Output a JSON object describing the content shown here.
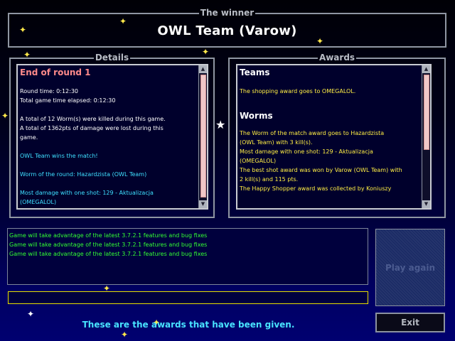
{
  "winner_panel": {
    "title": "The winner",
    "name": "OWL Team   (Varow)"
  },
  "details_panel": {
    "title": "Details",
    "round_heading": "End of round 1",
    "lines": [
      {
        "text": "Round time: 0:12:30",
        "color": "white"
      },
      {
        "text": "Total game time elapsed: 0:12:30",
        "color": "white"
      },
      {
        "text": "",
        "color": "white"
      },
      {
        "text": "A total of 12 Worm(s) were killed during this game.",
        "color": "white"
      },
      {
        "text": "A total of 1362pts of damage were lost during this",
        "color": "white"
      },
      {
        "text": "game.",
        "color": "white"
      },
      {
        "text": "",
        "color": "white"
      },
      {
        "text": "OWL Team wins the match!",
        "color": "cyan"
      },
      {
        "text": "",
        "color": "white"
      },
      {
        "text": "Worm of the round: Hazardzista (OWL Team)",
        "color": "cyan"
      },
      {
        "text": "",
        "color": "white"
      },
      {
        "text": "Most damage with one shot: 129 - Aktualizacja",
        "color": "cyan"
      },
      {
        "text": "(OMEGALOL)",
        "color": "cyan"
      }
    ]
  },
  "awards_panel": {
    "title": "Awards",
    "teams_heading": "Teams",
    "teams_lines": [
      "The shopping award goes to OMEGALOL."
    ],
    "worms_heading": "Worms",
    "worms_lines": [
      "The Worm of the match award goes to Hazardzista",
      "(OWL Team) with 3 kill(s).",
      "Most damage with one shot: 129 - Aktualizacja",
      "(OMEGALOL)",
      "The best shot award was won by Varow (OWL Team) with",
      "2 kill(s) and 115 pts.",
      "The Happy Shopper award was collected by Koniuszy"
    ]
  },
  "chat": {
    "lines": [
      "Game will take advantage of the latest 3.7.2.1 features and bug fixes",
      "Game will take advantage of the latest 3.7.2.1 features and bug fixes",
      "Game will take advantage of the latest 3.7.2.1 features and bug fixes"
    ],
    "input_value": ""
  },
  "buttons": {
    "play_again": "Play again",
    "exit": "Exit"
  },
  "status_text": "These are the awards that have been given.",
  "colors": {
    "round_heading": "#ff8a8a",
    "info_text": "#ffffff",
    "highlight_text": "#3ee0ff",
    "award_text": "#ffee44",
    "chat_text": "#33ff33",
    "status_text": "#48e3ff",
    "input_border": "#e9e000"
  }
}
